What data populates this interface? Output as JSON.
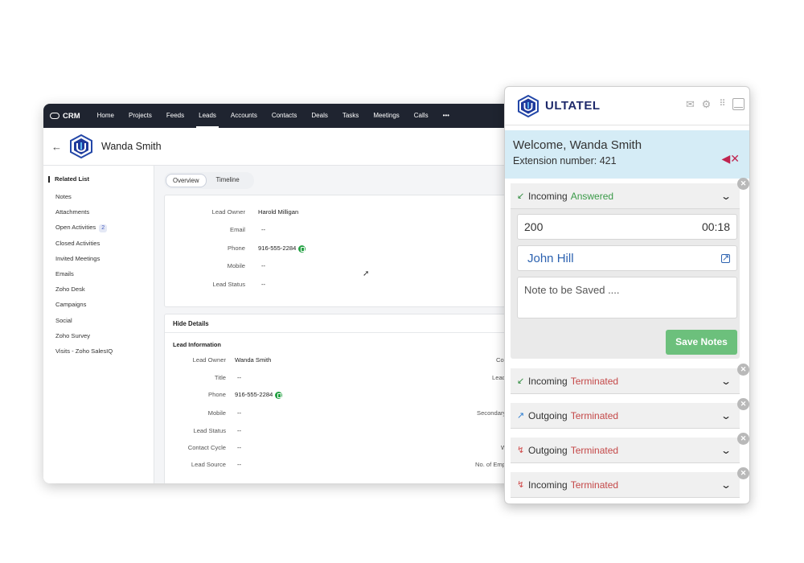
{
  "crm": {
    "app_name": "CRM",
    "nav": [
      "Home",
      "Projects",
      "Feeds",
      "Leads",
      "Accounts",
      "Contacts",
      "Deals",
      "Tasks",
      "Meetings",
      "Calls"
    ],
    "nav_more": "•••",
    "active_nav": "Leads",
    "lead_name": "Wanda Smith",
    "related_list": {
      "title": "Related List",
      "items": [
        "Notes",
        "Attachments",
        "Open Activities",
        "Closed Activities",
        "Invited Meetings",
        "Emails",
        "Zoho Desk",
        "Campaigns",
        "Social",
        "Zoho Survey",
        "Visits - Zoho SalesIQ"
      ],
      "open_activities_count": "2"
    },
    "tabs": [
      "Overview",
      "Timeline"
    ],
    "overview": {
      "lead_owner_label": "Lead Owner",
      "lead_owner": "Harold Milligan",
      "email_label": "Email",
      "email": "--",
      "phone_label": "Phone",
      "phone": "916-555-2284",
      "mobile_label": "Mobile",
      "mobile": "--",
      "lead_status_label": "Lead Status",
      "lead_status": "--"
    },
    "details": {
      "hide_details": "Hide Details",
      "section_title": "Lead Information",
      "lead_owner_label": "Lead Owner",
      "lead_owner": "Wanda Smith",
      "title_label": "Title",
      "title": "--",
      "phone_label": "Phone",
      "phone": "916-555-2284",
      "mobile_label": "Mobile",
      "mobile": "--",
      "lead_status_label": "Lead Status",
      "lead_status": "--",
      "contact_cycle_label": "Contact Cycle",
      "contact_cycle": "--",
      "lead_source_label": "Lead Source",
      "lead_source": "--",
      "right_col": [
        "Co",
        "Lead",
        "Secondary",
        "W",
        "No. of Emp"
      ]
    }
  },
  "ultatel": {
    "brand": "ULTATEL",
    "welcome": "Welcome, Wanda Smith",
    "extension": "Extension number: 421",
    "active_call": {
      "direction": "Incoming",
      "status": "Answered",
      "number": "200",
      "duration": "00:18",
      "contact": "John Hill",
      "note_placeholder": "Note to be Saved ....",
      "save_label": "Save Notes"
    },
    "history": [
      {
        "direction": "Incoming",
        "status": "Terminated"
      },
      {
        "direction": "Outgoing",
        "status": "Terminated"
      },
      {
        "direction": "Outgoing",
        "status": "Terminated"
      },
      {
        "direction": "Incoming",
        "status": "Terminated"
      }
    ],
    "colors": {
      "answered": "#3a9a48",
      "terminated": "#c44848",
      "save": "#6cc07c",
      "brand": "#1f2a6b"
    }
  }
}
